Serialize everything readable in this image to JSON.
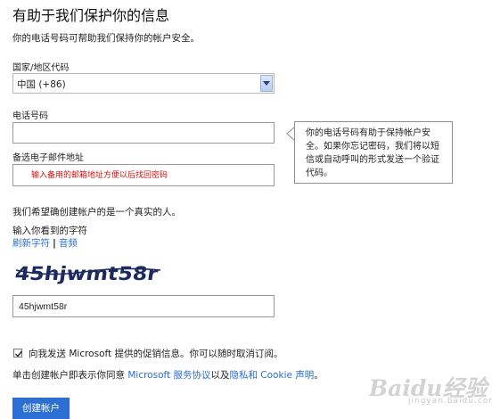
{
  "page": {
    "title": "有助于我们保护你的信息",
    "subtitle": "你的电话号码可帮助我们保持你的帐户安全。"
  },
  "country": {
    "label": "国家/地区代码",
    "selected": "中国 (+86)"
  },
  "phone": {
    "label": "电话号码",
    "value": ""
  },
  "email": {
    "label": "备选电子邮件地址",
    "annotation": "输入备用的邮箱地址方便以后找回密码"
  },
  "tooltip": {
    "text": "你的电话号码有助于保持帐户安全。如果你忘记密码，我们将以短信或自动呼叫的形式发送一个验证代码。"
  },
  "captcha": {
    "human_note": "我们希望确创建帐户的是一个真实的人。",
    "label": "输入你看到的字符",
    "refresh_link": "刷新字符",
    "separator": "|",
    "audio_link": "音频",
    "image_text": "45hjwmt58r",
    "value": "45hjwmt58r"
  },
  "promo": {
    "checked": true,
    "label": "向我发送 Microsoft 提供的促销信息。你可以随时取消订阅。"
  },
  "terms": {
    "prefix": "单击创建帐户即表示你同意 ",
    "service_link": "Microsoft 服务协议",
    "middle": "以及",
    "privacy_link": "隐私和 Cookie 声明",
    "suffix": "。"
  },
  "actions": {
    "create_label": "创建帐户"
  },
  "watermark": {
    "main": "Baidu经验",
    "sub": "jingyan.baidu.com"
  },
  "colors": {
    "link": "#2a6fd1",
    "button": "#2b6fd2",
    "annotation": "#d01010"
  }
}
